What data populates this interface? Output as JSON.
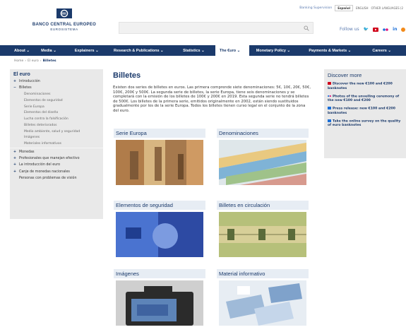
{
  "topbar": {
    "links": [
      "Banking Supervision"
    ],
    "languages": [
      "Español",
      "ENGLISH",
      "OTHER LANGUAGES (2"
    ]
  },
  "header": {
    "org_name": "BANCO CENTRAL EUROPEO",
    "org_sub": "EUROSISTEMA",
    "follow_label": "Follow us",
    "social": [
      "twitter-icon",
      "youtube-icon",
      "flickr-icon",
      "linkedin-icon"
    ]
  },
  "nav": {
    "items": [
      {
        "label": "About ⌄"
      },
      {
        "label": "Media ⌄"
      },
      {
        "label": "Explainers ⌄"
      },
      {
        "label": "Research & Publications ⌄"
      },
      {
        "label": "Statistics ⌄"
      },
      {
        "label": "The €uro ⌄"
      },
      {
        "label": "Monetary Policy ⌄"
      },
      {
        "label": "Payments & Markets ⌄"
      },
      {
        "label": "Careers ⌄"
      }
    ]
  },
  "breadcrumb": {
    "items": [
      "Home",
      "El euro",
      "Billetes"
    ]
  },
  "sidebar": {
    "title": "El euro",
    "top": [
      {
        "pm": "+",
        "label": "Introducción"
      },
      {
        "pm": "−",
        "label": "Billetes"
      }
    ],
    "sub": [
      "Denominaciones",
      "Elementos de seguridad",
      "Serie Europa",
      "Elementos del diseño",
      "Lucha contra la falsificación",
      "Billetes deteriorados",
      "Medio ambiente, salud y seguridad",
      "Imágenes",
      "Materiales informativos"
    ],
    "bottom": [
      {
        "pm": "+",
        "label": "Monedas"
      },
      {
        "pm": "+",
        "label": "Profesionales que manejan efectivo"
      },
      {
        "pm": "+",
        "label": "La introducción del euro"
      },
      {
        "pm": "+",
        "label": "Canje de monedas nacionales"
      },
      {
        "pm": "",
        "label": "Personas con problemas de visión"
      }
    ]
  },
  "main": {
    "title": "Billetes",
    "intro": "Existen dos series de billetes en euros. Las primera comprende siete denominaciones: 5€, 10€, 20€, 50€, 100€, 200€ y 500€. La segunda serie de billetes, la serie Europa, tiene seis denominaciones y se completará con la emisión de los billetes de 100€ y 200€ en 2019. Esta segunda serie no tendrá billetes de 500€. Los billetes de la primera serie, emitidos originalmente en 2002, están siendo sustituidos gradualmente por los de la serie Europa. Todos los billetes tienen curso legal en el conjunto de la zona del euro.",
    "tiles": [
      {
        "title": "Serie Europa"
      },
      {
        "title": "Denominaciones"
      },
      {
        "title": "Elementos de seguridad"
      },
      {
        "title": "Billetes en circulación"
      },
      {
        "title": "Imágenes"
      },
      {
        "title": "Material informativo"
      }
    ]
  },
  "discover": {
    "title": "Discover more",
    "items": [
      {
        "icon": "youtube-icon",
        "text": "Discover the new €100 and €200 banknotes"
      },
      {
        "icon": "flickr-icon",
        "text": "Photos of the unveiling ceremony of the new €100 and €200"
      },
      {
        "icon": "document-icon",
        "text": "Press release: new €100 and €200 banknotes"
      },
      {
        "icon": "document-icon",
        "text": "Take the online survey on the quality of euro banknotes"
      }
    ]
  },
  "colors": {
    "brand": "#1b3a6b",
    "accent": "#5a7ab0",
    "sidebar_bg": "#e9e9e9"
  }
}
